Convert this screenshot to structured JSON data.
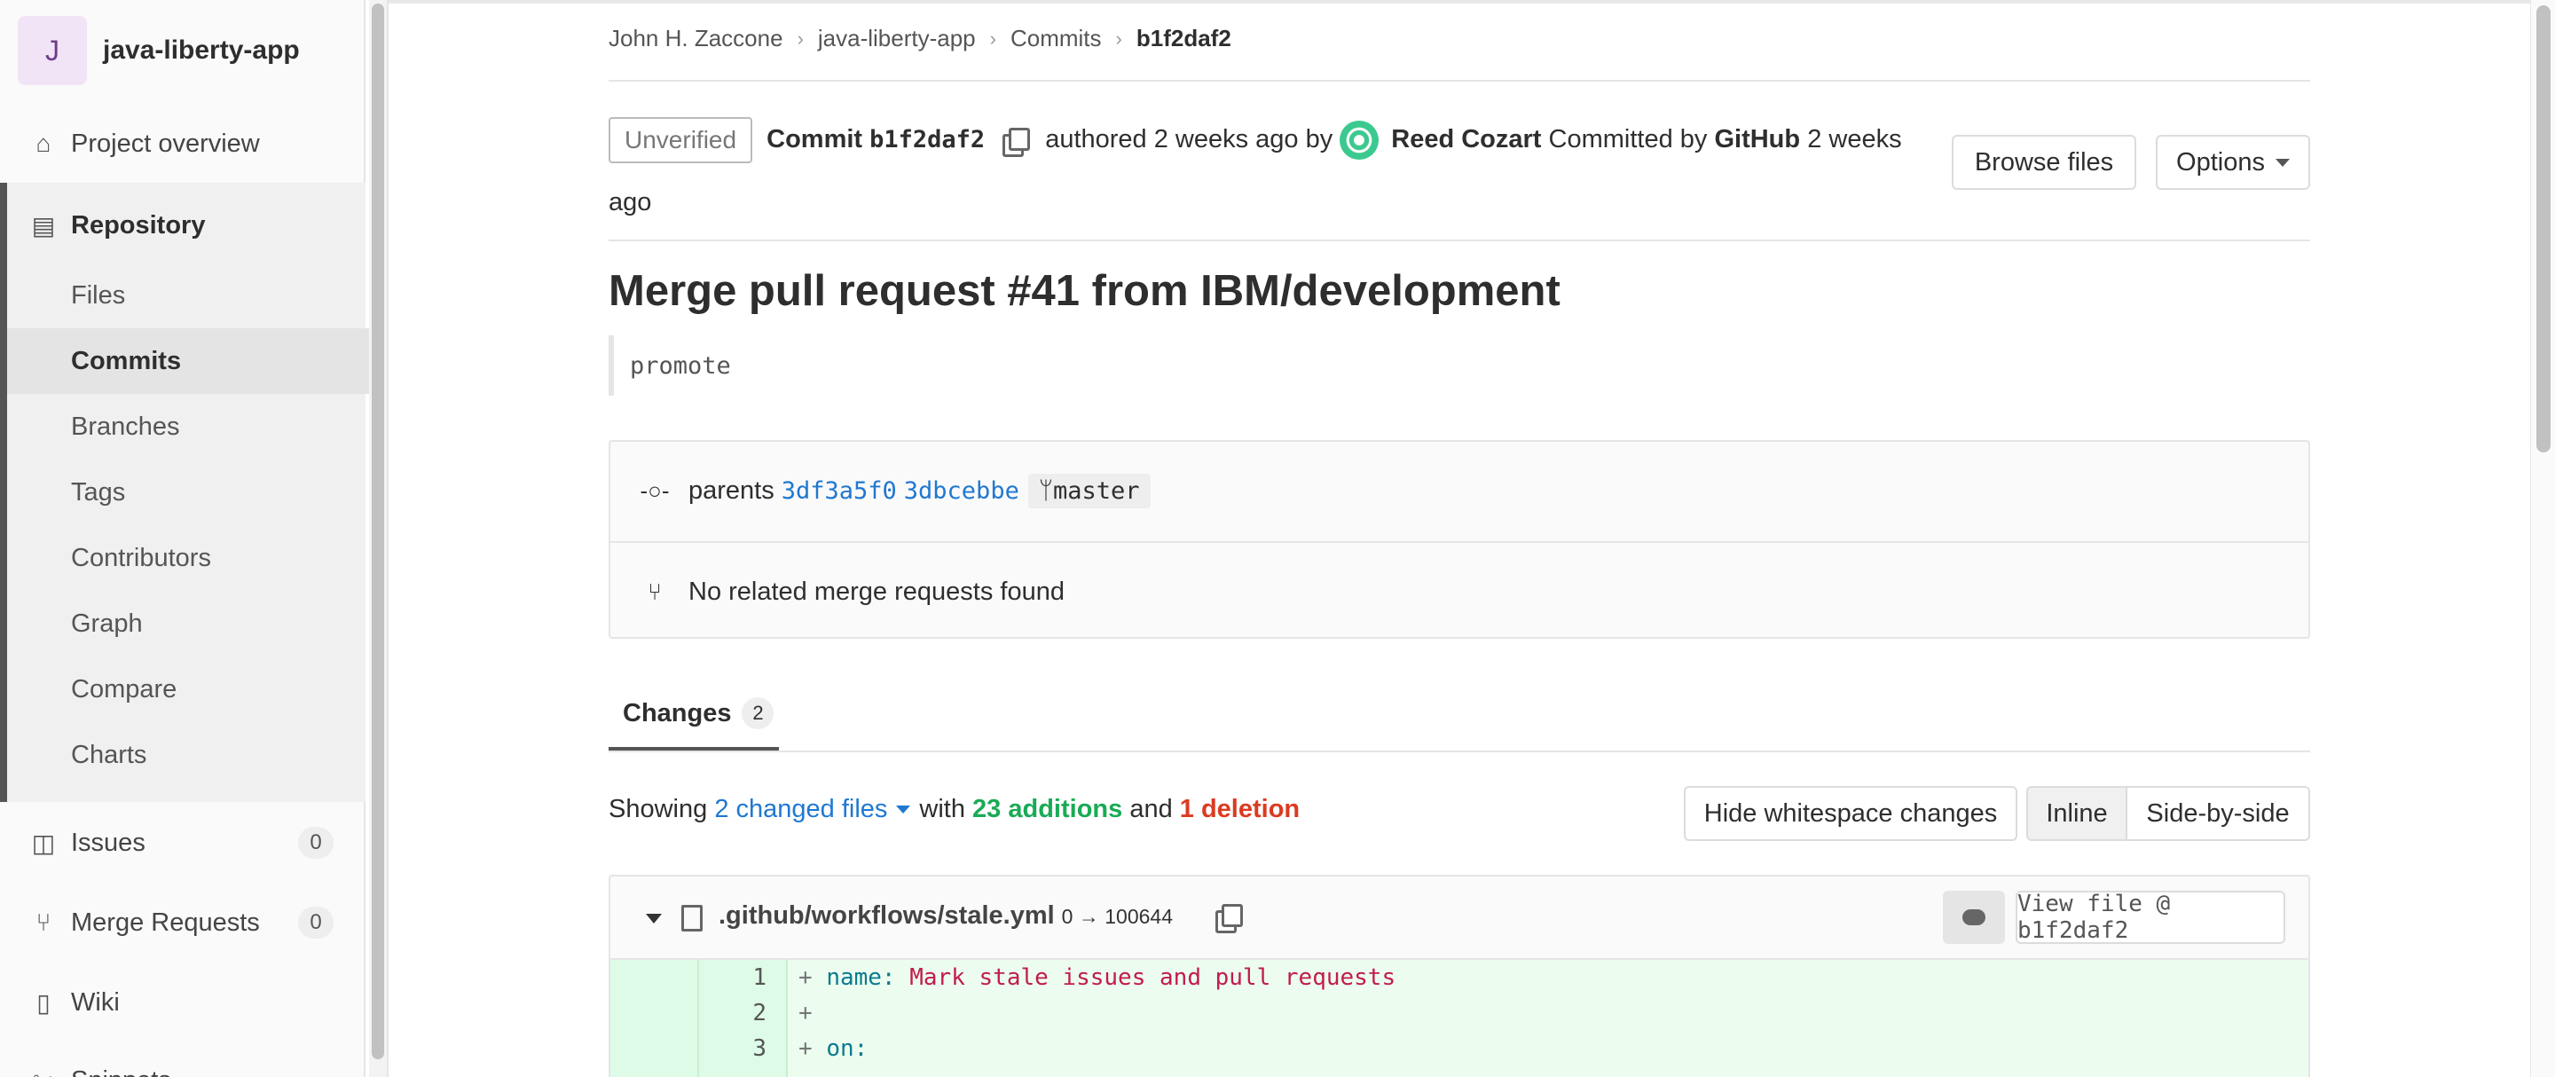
{
  "project": {
    "avatar_letter": "J",
    "name": "java-liberty-app"
  },
  "sidebar": {
    "project_overview": "Project overview",
    "repository": "Repository",
    "repo_items": [
      "Files",
      "Commits",
      "Branches",
      "Tags",
      "Contributors",
      "Graph",
      "Compare",
      "Charts"
    ],
    "active_item": "Commits",
    "issues": {
      "label": "Issues",
      "count": "0"
    },
    "merge_requests": {
      "label": "Merge Requests",
      "count": "0"
    },
    "wiki": "Wiki",
    "snippets": "Snippets"
  },
  "breadcrumb": [
    "John H. Zaccone",
    "java-liberty-app",
    "Commits",
    "b1f2daf2"
  ],
  "commit": {
    "badge": "Unverified",
    "label": "Commit",
    "sha": "b1f2daf2",
    "authored": "authored 2 weeks ago by",
    "author": "Reed Cozart",
    "committed_by": "Committed by",
    "committer": "GitHub",
    "committed_when": "2 weeks ago",
    "browse_files": "Browse files",
    "options": "Options",
    "title": "Merge pull request #41 from IBM/development",
    "description": "promote"
  },
  "parents": {
    "label": "parents",
    "shas": [
      "3df3a5f0",
      "3dbcebbe"
    ],
    "branch": "master"
  },
  "merge_requests_text": "No related merge requests found",
  "tabs": {
    "changes_label": "Changes",
    "changes_count": "2"
  },
  "summary": {
    "showing": "Showing",
    "changed_files": "2 changed files",
    "with": "with",
    "additions": "23 additions",
    "and": "and",
    "deletions": "1 deletion",
    "hide_whitespace": "Hide whitespace changes",
    "inline": "Inline",
    "side_by_side": "Side-by-side"
  },
  "file": {
    "path": ".github/workflows/stale.yml",
    "mode": "0 → 100644",
    "view_file": "View file @ b1f2daf2"
  },
  "diff_lines": [
    {
      "num": "1",
      "key": "name:",
      "value": " Mark stale issues and pull requests"
    },
    {
      "num": "2",
      "key": "",
      "value": ""
    },
    {
      "num": "3",
      "key": "on:",
      "value": ""
    }
  ],
  "colors": {
    "accent_link": "#1f78d1",
    "addition": "#1aaa55",
    "deletion": "#db3b21",
    "diff_bg": "#ecfdf0"
  }
}
